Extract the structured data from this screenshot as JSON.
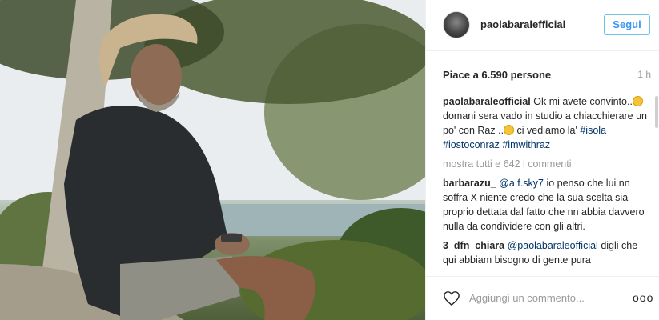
{
  "post": {
    "username": "paolabaralefficial",
    "follow_label": "Segui",
    "likes": "Piace a 6.590 persone",
    "time": "1 h"
  },
  "caption": {
    "username": "paolabaraleofficial",
    "text_1": "Ok mi avete convinto..",
    "text_2": "domani sera vado in studio a chiacchierare un po' con Raz ..",
    "text_3": "ci vediamo la'",
    "tag_1": "#isola",
    "tag_2": "#iostoconraz",
    "tag_3": "#imwithraz"
  },
  "view_all": "mostra tutti e 642 i commenti",
  "comments": [
    {
      "username": "barbarazu_",
      "mention": "@a.f.sky7",
      "text": "io penso che lui nn soffra X niente credo che la sua scelta sia proprio dettata dal fatto che nn abbia davvero nulla da condividere con gli altri."
    },
    {
      "username": "3_dfn_chiara",
      "mention": "@paolabaraleofficial",
      "text": "digli che qui abbiam bisogno di gente pura"
    }
  ],
  "footer": {
    "add_comment_placeholder": "Aggiungi un commento...",
    "more_label": "ooo"
  },
  "icons": {
    "like": "heart-icon",
    "more": "more-options-icon",
    "emoji_1": "thumbs-up-emoji-icon",
    "emoji_2": "smiley-emoji-icon"
  }
}
